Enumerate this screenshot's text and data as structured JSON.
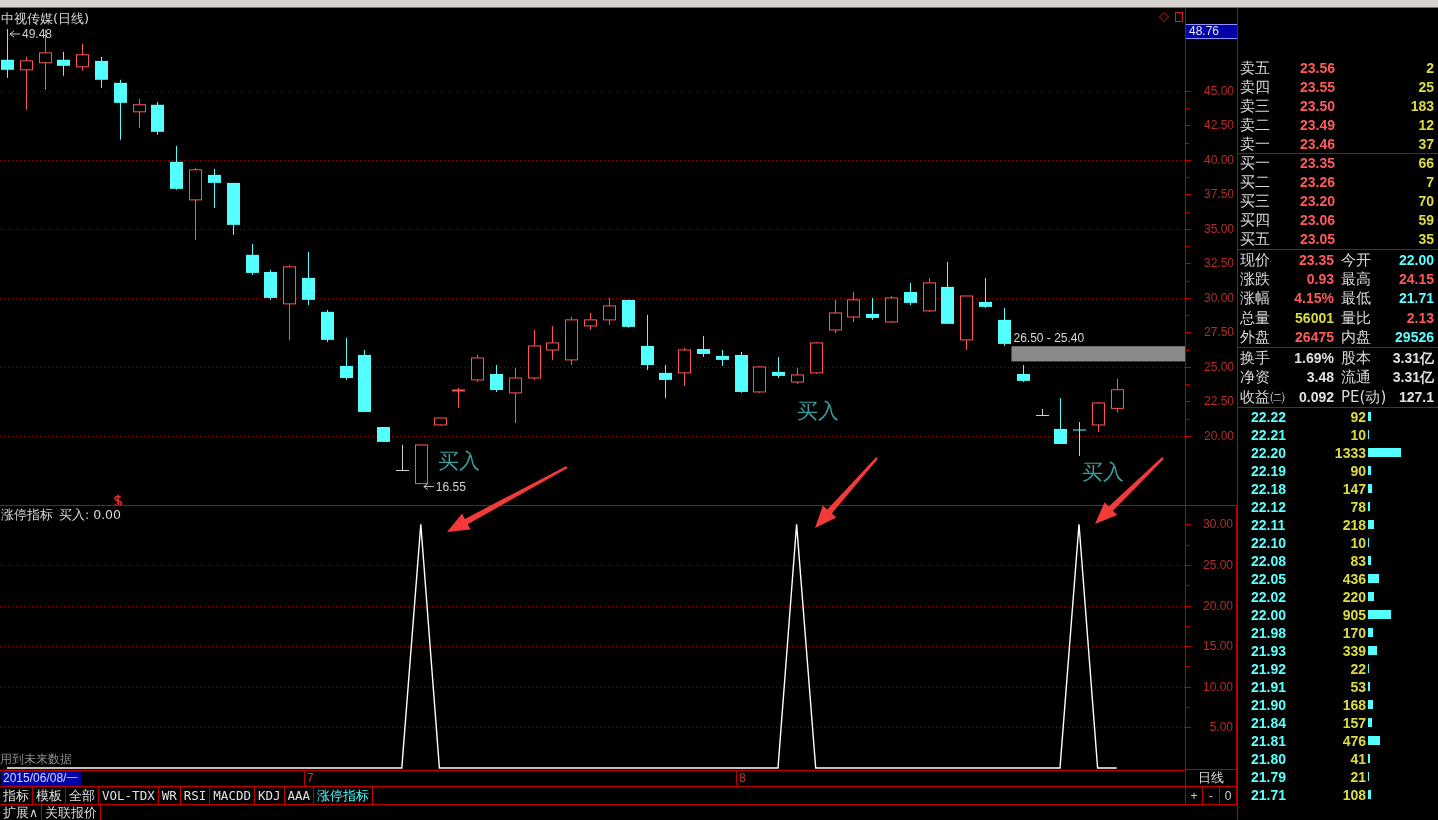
{
  "kline": {
    "title": "中视传媒(日线)",
    "cursor_value": "48.76",
    "price_axis": [
      "45.00",
      "42.50",
      "40.00",
      "37.50",
      "35.00",
      "32.50",
      "30.00",
      "27.50",
      "25.00",
      "22.50",
      "20.00"
    ],
    "high_label": "49.48",
    "low_label": "16.55",
    "signal_labels": [
      "买入",
      "买入",
      "买入"
    ],
    "range_label": "26.50 - 25.40"
  },
  "indicator": {
    "legend": "买入: 0.00",
    "note": "用到未来数据",
    "cursor_date": "2015/06/08/一",
    "period": "日线",
    "chart_data": {
      "type": "line",
      "title": "涨停指标",
      "grid": true,
      "xlim": [
        6.288,
        9.028
      ],
      "ylim": [
        -0.25,
        32.25
      ],
      "x": [
        6.304,
        6.348,
        6.391,
        6.435,
        6.478,
        6.522,
        6.565,
        6.609,
        6.652,
        6.696,
        6.739,
        6.783,
        6.826,
        6.87,
        6.913,
        6.957,
        7,
        7.043,
        7.087,
        7.13,
        7.174,
        7.217,
        7.261,
        7.304,
        7.348,
        7.391,
        7.435,
        7.478,
        7.522,
        7.565,
        7.609,
        7.652,
        7.696,
        7.739,
        7.783,
        7.826,
        7.87,
        7.913,
        7.957,
        8,
        8.043,
        8.087,
        8.13,
        8.174,
        8.217,
        8.261,
        8.304,
        8.348,
        8.391,
        8.435,
        8.478,
        8.522,
        8.565,
        8.609,
        8.652,
        8.696,
        8.739,
        8.783,
        8.826,
        8.87
      ],
      "xticks": [
        {
          "value": 7,
          "label": "7"
        },
        {
          "value": 8,
          "label": "8"
        }
      ],
      "yticks": [
        {
          "value": 5,
          "label": "5.00"
        },
        {
          "value": 10,
          "label": "10.00"
        },
        {
          "value": 15,
          "label": "15.00"
        },
        {
          "value": 20,
          "label": "20.00"
        },
        {
          "value": 25,
          "label": "25.00"
        },
        {
          "value": 30,
          "label": "30.00"
        }
      ],
      "series": [
        {
          "color": "#ffffff",
          "values": [
            0,
            0,
            0,
            0,
            0,
            0,
            0,
            0,
            0,
            0,
            0,
            0,
            0,
            0,
            0,
            0,
            0,
            0,
            0,
            0,
            0,
            0,
            30,
            0,
            0,
            0,
            0,
            0,
            0,
            0,
            0,
            0,
            0,
            0,
            0,
            0,
            0,
            0,
            0,
            0,
            0,
            0,
            30,
            0,
            0,
            0,
            0,
            0,
            0,
            0,
            0,
            0,
            0,
            0,
            0,
            0,
            0,
            30,
            0,
            0
          ]
        }
      ]
    }
  },
  "indicator_tabs": [
    {
      "label": "指标",
      "selected": false
    },
    {
      "label": "模板",
      "selected": false
    },
    {
      "label": "全部",
      "selected": false
    },
    {
      "label": "VOL-TDX",
      "selected": false
    },
    {
      "label": "WR",
      "selected": false
    },
    {
      "label": "RSI",
      "selected": false
    },
    {
      "label": "MACDD",
      "selected": false
    },
    {
      "label": "KDJ",
      "selected": false
    },
    {
      "label": "AAA",
      "selected": false
    },
    {
      "label": "涨停指标",
      "selected": true
    }
  ],
  "zoom_buttons": [
    "+",
    "-",
    "0"
  ],
  "bottom_buttons": [
    "扩展∧",
    "关联报价"
  ],
  "sell_orders": [
    {
      "label": "卖五",
      "price": "23.56",
      "volume": "2"
    },
    {
      "label": "卖四",
      "price": "23.55",
      "volume": "25"
    },
    {
      "label": "卖三",
      "price": "23.50",
      "volume": "183"
    },
    {
      "label": "卖二",
      "price": "23.49",
      "volume": "12"
    },
    {
      "label": "卖一",
      "price": "23.46",
      "volume": "37"
    }
  ],
  "buy_orders": [
    {
      "label": "买一",
      "price": "23.35",
      "volume": "66"
    },
    {
      "label": "买二",
      "price": "23.26",
      "volume": "7"
    },
    {
      "label": "买三",
      "price": "23.20",
      "volume": "70"
    },
    {
      "label": "买四",
      "price": "23.06",
      "volume": "59"
    },
    {
      "label": "买五",
      "price": "23.05",
      "volume": "35"
    }
  ],
  "quote_stats": [
    {
      "label": "现价",
      "value": "23.35",
      "color": "#ff5a5a"
    },
    {
      "label": "今开",
      "value": "22.00",
      "color": "#5affff"
    },
    {
      "label": "涨跌",
      "value": "0.93",
      "color": "#ff5a5a"
    },
    {
      "label": "最高",
      "value": "24.15",
      "color": "#ff5a5a"
    },
    {
      "label": "涨幅",
      "value": "4.15%",
      "color": "#ff5a5a"
    },
    {
      "label": "最低",
      "value": "21.71",
      "color": "#5affff"
    },
    {
      "label": "总量",
      "value": "56001",
      "color": "#dcdc40"
    },
    {
      "label": "量比",
      "value": "2.13",
      "color": "#ff5a5a"
    },
    {
      "label": "外盘",
      "value": "26475",
      "color": "#ff5a5a"
    },
    {
      "label": "内盘",
      "value": "29526",
      "color": "#5affff"
    }
  ],
  "share_stats": [
    {
      "label": "换手",
      "value": "1.69%",
      "color": "#e0e0e0"
    },
    {
      "label": "股本",
      "value": "3.31亿",
      "color": "#e0e0e0"
    },
    {
      "label": "净资",
      "value": "3.48",
      "color": "#e0e0e0"
    },
    {
      "label": "流通",
      "value": "3.31亿",
      "color": "#e0e0e0"
    },
    {
      "label": "收益㈡",
      "value": "0.092",
      "color": "#e0e0e0"
    },
    {
      "label": "PE(动)",
      "value": "127.1",
      "color": "#e0e0e0"
    }
  ],
  "trades": [
    {
      "price": "22.22",
      "volume": "92"
    },
    {
      "price": "22.21",
      "volume": "10"
    },
    {
      "price": "22.20",
      "volume": "1333"
    },
    {
      "price": "22.19",
      "volume": "90"
    },
    {
      "price": "22.18",
      "volume": "147"
    },
    {
      "price": "22.12",
      "volume": "78"
    },
    {
      "price": "22.11",
      "volume": "218"
    },
    {
      "price": "22.10",
      "volume": "10"
    },
    {
      "price": "22.08",
      "volume": "83"
    },
    {
      "price": "22.05",
      "volume": "436"
    },
    {
      "price": "22.02",
      "volume": "220"
    },
    {
      "price": "22.00",
      "volume": "905"
    },
    {
      "price": "21.98",
      "volume": "170"
    },
    {
      "price": "21.93",
      "volume": "339"
    },
    {
      "price": "21.92",
      "volume": "22"
    },
    {
      "price": "21.91",
      "volume": "53"
    },
    {
      "price": "21.90",
      "volume": "168"
    },
    {
      "price": "21.84",
      "volume": "157"
    },
    {
      "price": "21.81",
      "volume": "476"
    },
    {
      "price": "21.80",
      "volume": "41"
    },
    {
      "price": "21.79",
      "volume": "21"
    },
    {
      "price": "21.71",
      "volume": "108"
    }
  ]
}
